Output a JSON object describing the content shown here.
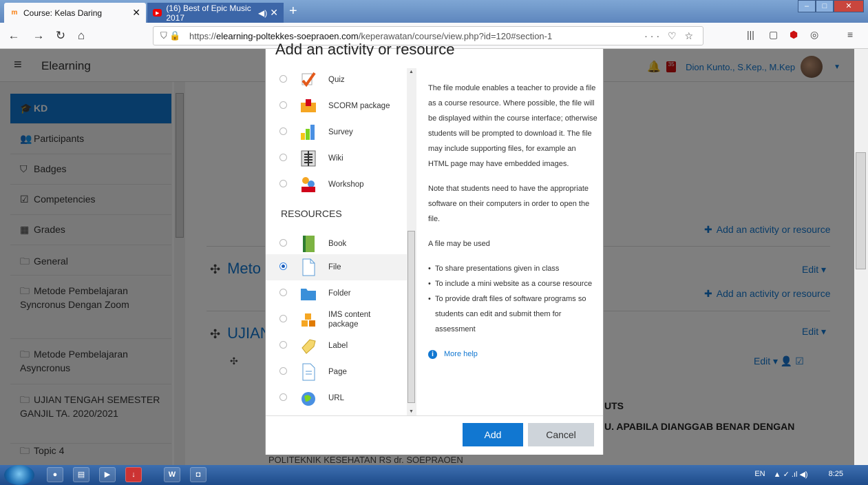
{
  "browser": {
    "tabs": [
      {
        "title": "Course: Kelas Daring",
        "close": "✕"
      },
      {
        "title": "(16) Best of Epic Music 2017",
        "audio": "◀)",
        "close": "✕"
      }
    ],
    "new_tab": "+",
    "url_prefix": "https://",
    "url_domain": "elearning-poltekkes-soepraoen.com",
    "url_path": "/keperawatan/course/view.php?id=120#section-1",
    "url_actions": "··· ♡ ☆"
  },
  "header": {
    "brand": "Elearning",
    "message_count": "35",
    "user_name": "Dion Kunto., S.Kep., M.Kep"
  },
  "sidebar": {
    "items": [
      {
        "label": "KD",
        "icon": "graduation-cap-icon"
      },
      {
        "label": "Participants",
        "icon": "users-icon"
      },
      {
        "label": "Badges",
        "icon": "shield-icon"
      },
      {
        "label": "Competencies",
        "icon": "checkbox-icon"
      },
      {
        "label": "Grades",
        "icon": "table-icon"
      },
      {
        "label": "General",
        "icon": "folder-icon"
      },
      {
        "label": "Metode Pembelajaran Syncronus Dengan Zoom",
        "icon": "folder-icon"
      },
      {
        "label": "Metode Pembelajaran Asyncronus",
        "icon": "folder-icon"
      },
      {
        "label": "UJIAN TENGAH SEMESTER GANJIL TA. 2020/2021",
        "icon": "folder-icon"
      },
      {
        "label": "Topic 4",
        "icon": "folder-icon"
      }
    ]
  },
  "main": {
    "add_activity": "Add an activity or resource",
    "section_metode": "Meto",
    "section_ujian": "UJIAN",
    "edit": "Edit",
    "bold_1": "UTS",
    "bold_2": "U. APABILA DIANGGAB BENAR DENGAN",
    "footer": "POLITEKNIK KESEHATAN RS dr. SOEPRAOEN"
  },
  "modal": {
    "title": "Add an activity or resource",
    "activities": [
      {
        "label": "Quiz",
        "icon": "quiz-icon"
      },
      {
        "label": "SCORM package",
        "icon": "scorm-icon"
      },
      {
        "label": "Survey",
        "icon": "survey-icon"
      },
      {
        "label": "Wiki",
        "icon": "wiki-icon"
      },
      {
        "label": "Workshop",
        "icon": "workshop-icon"
      }
    ],
    "resources_header": "RESOURCES",
    "resources": [
      {
        "label": "Book",
        "icon": "book-icon"
      },
      {
        "label": "File",
        "icon": "file-icon",
        "selected": true
      },
      {
        "label": "Folder",
        "icon": "folder-icon"
      },
      {
        "label": "IMS content package",
        "icon": "ims-icon"
      },
      {
        "label": "Label",
        "icon": "label-icon"
      },
      {
        "label": "Page",
        "icon": "page-icon"
      },
      {
        "label": "URL",
        "icon": "url-icon"
      }
    ],
    "help_p1": "The file module enables a teacher to provide a file as a course resource. Where possible, the file will be displayed within the course interface; otherwise students will be prompted to download it. The file may include supporting files, for example an HTML page may have embedded images.",
    "help_p2": "Note that students need to have the appropriate software on their computers in order to open the file.",
    "help_p3": "A file may be used",
    "help_list": [
      "To share presentations given in class",
      "To include a mini website as a course resource",
      "To provide draft files of software programs so students can edit and submit them for assessment"
    ],
    "more_help": "More help",
    "add_button": "Add",
    "cancel_button": "Cancel"
  },
  "taskbar": {
    "lang": "EN",
    "time": "8:25"
  }
}
